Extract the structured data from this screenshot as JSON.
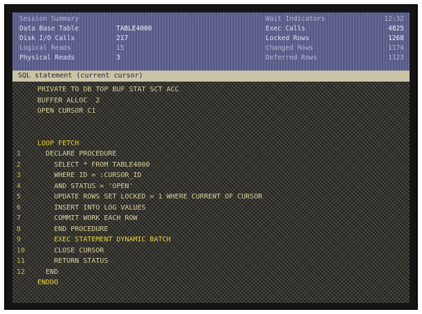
{
  "status": {
    "left": [
      {
        "k": "Session Summary",
        "v": ""
      },
      {
        "k": "Data Base Table",
        "v": "TABLE4000"
      },
      {
        "k": "Disk I/O Calls",
        "v": "217"
      },
      {
        "k": "Logical Reads",
        "v": "15"
      },
      {
        "k": "Physical Reads",
        "v": "3"
      }
    ],
    "right": [
      {
        "k": "Wait Indicators",
        "v": "12:32"
      },
      {
        "k": "Exec Calls",
        "v": "4825"
      },
      {
        "k": "Locked Rows",
        "v": "1268"
      },
      {
        "k": "Changed Rows",
        "v": "1174"
      },
      {
        "k": "Deferred Rows",
        "v": "1123"
      }
    ]
  },
  "header_line": "SQL statement (current cursor)",
  "code": {
    "lines": [
      {
        "ln": "",
        "text": "PRIVATE TO DB TOP BUF STAT SCT ACC"
      },
      {
        "ln": "",
        "text": "BUFFER ALLOC  2"
      },
      {
        "ln": "",
        "text": "OPEN CURSOR C1"
      },
      {
        "ln": "",
        "text": ""
      },
      {
        "ln": "",
        "text": ""
      },
      {
        "ln": "",
        "text": "LOOP FETCH"
      },
      {
        "ln": "1",
        "text": "  DECLARE PROCEDURE"
      },
      {
        "ln": "2",
        "text": "    SELECT * FROM TABLE4000"
      },
      {
        "ln": "3",
        "text": "    WHERE ID = :CURSOR_ID"
      },
      {
        "ln": "4",
        "text": "    AND STATUS = 'OPEN'"
      },
      {
        "ln": "5",
        "text": "    UPDATE ROWS SET LOCKED = 1 WHERE CURRENT OF CURSOR"
      },
      {
        "ln": "6",
        "text": "    INSERT INTO LOG VALUES"
      },
      {
        "ln": "7",
        "text": "    COMMIT WORK EACH ROW"
      },
      {
        "ln": "8",
        "text": "    END PROCEDURE"
      },
      {
        "ln": "9",
        "text": "    EXEC STATEMENT DYNAMIC BATCH"
      },
      {
        "ln": "10",
        "text": "    CLOSE CURSOR"
      },
      {
        "ln": "11",
        "text": "    RETURN STATUS"
      },
      {
        "ln": "12",
        "text": "  END"
      },
      {
        "ln": "",
        "text": "ENDDO"
      }
    ]
  }
}
